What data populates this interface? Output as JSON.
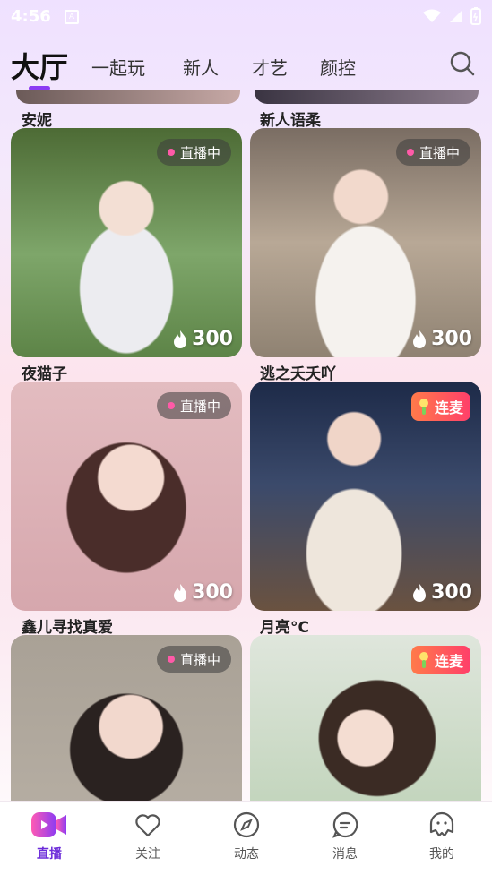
{
  "status_bar": {
    "time": "4:56",
    "a_icon": "A"
  },
  "tabs": [
    {
      "label": "大厅",
      "active": true
    },
    {
      "label": "一起玩",
      "active": false
    },
    {
      "label": "新人",
      "active": false
    },
    {
      "label": "才艺",
      "active": false
    },
    {
      "label": "颜控",
      "active": false
    }
  ],
  "top_row_names": [
    "安妮",
    "新人语柔"
  ],
  "cards": [
    {
      "name": "夜猫子",
      "badge": "直播中",
      "badge_type": "live",
      "heat": "300",
      "theme": "#7ea66a"
    },
    {
      "name": "逃之夭夭吖",
      "badge": "直播中",
      "badge_type": "live",
      "heat": "300",
      "theme": "#b8a896"
    },
    {
      "name": "鑫儿寻找真爱",
      "badge": "直播中",
      "badge_type": "live",
      "heat": "300",
      "theme": "#d6a7ad"
    },
    {
      "name": "月亮°C",
      "badge": "连麦",
      "badge_type": "lianmai",
      "heat": "300",
      "theme": "#3b4a6b"
    },
    {
      "name": "",
      "badge": "直播中",
      "badge_type": "live",
      "heat": "",
      "theme": "#b9b1a6"
    },
    {
      "name": "",
      "badge": "连麦",
      "badge_type": "lianmai",
      "heat": "",
      "theme": "#b9cfb2"
    }
  ],
  "nav": [
    {
      "label": "直播",
      "icon": "live-video-icon",
      "active": true
    },
    {
      "label": "关注",
      "icon": "heart-icon",
      "active": false
    },
    {
      "label": "动态",
      "icon": "compass-icon",
      "active": false
    },
    {
      "label": "消息",
      "icon": "message-icon",
      "active": false
    },
    {
      "label": "我的",
      "icon": "profile-icon",
      "active": false
    }
  ],
  "colors": {
    "accent": "#8b3bf3",
    "live_dot": "#ff5aa8"
  }
}
